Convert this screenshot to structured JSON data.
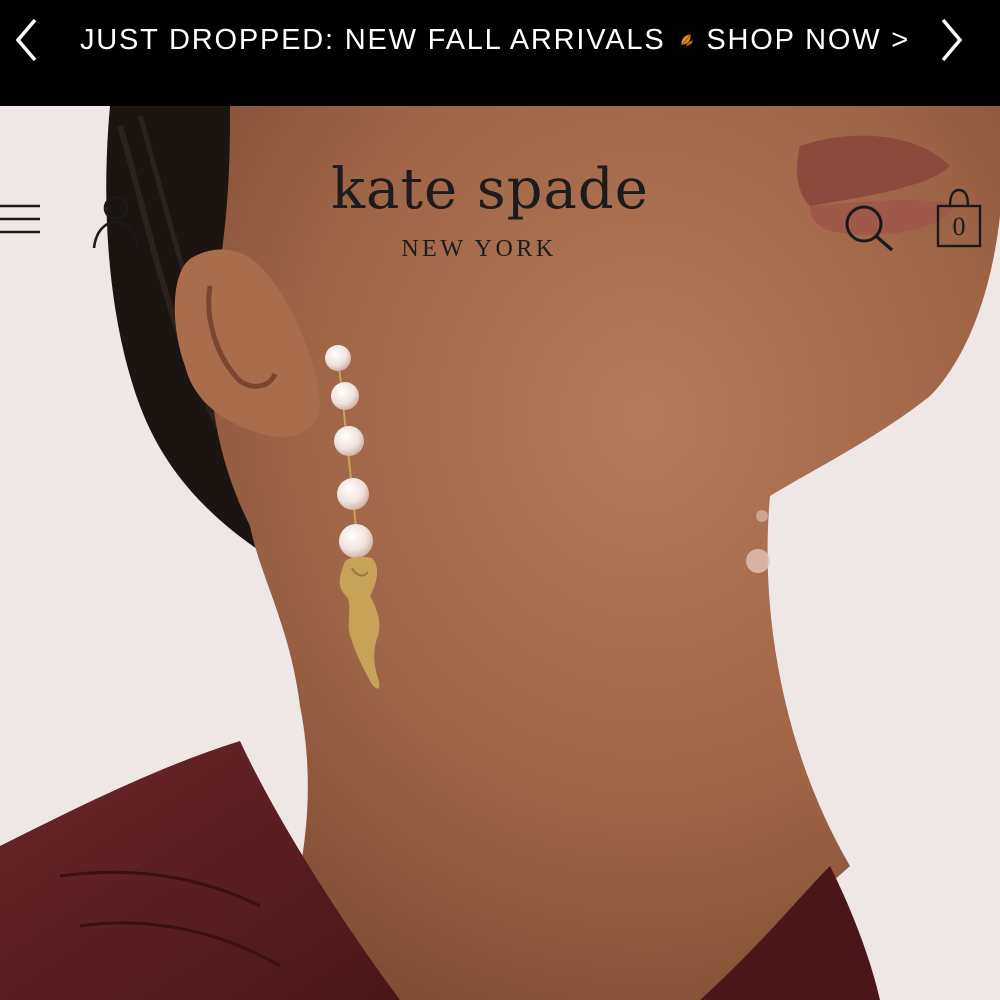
{
  "promo_banner": {
    "text_before": "JUST DROPPED: NEW FALL ARRIVALS",
    "text_after": "SHOP NOW >",
    "leaf_icon": "autumn-leaf-icon",
    "prev_icon": "chevron-left-icon",
    "next_icon": "chevron-right-icon"
  },
  "header": {
    "brand_name": "kate spade",
    "brand_location": "NEW YORK",
    "bag_count": "0",
    "icons": [
      "menu-icon",
      "account-icon",
      "search-icon",
      "shopping-bag-icon"
    ]
  },
  "hero": {
    "subject": "model wearing gold drop earring with pavé spheres and cat charm"
  },
  "colors": {
    "banner_bg": "#000000",
    "banner_text": "#ffffff",
    "page_bg": "#efe6e6",
    "skin": "#a86e4e",
    "top": "#5a1f22",
    "gold": "#c9a25a"
  }
}
